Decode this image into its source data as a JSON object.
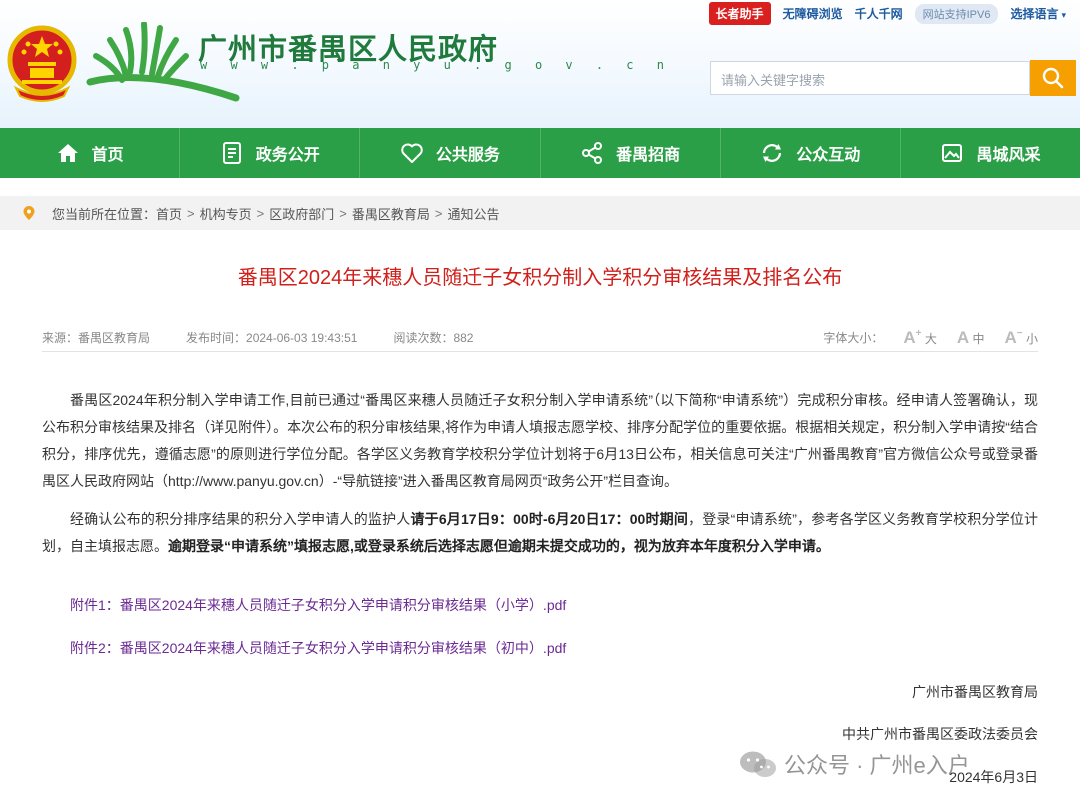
{
  "site": {
    "title": "广州市番禺区人民政府",
    "url": "w w w . p a n y u . g o v . c n"
  },
  "topbar": {
    "elder": "长者助手",
    "accessible": "无障碍浏览",
    "thousand": "千人千网",
    "ipv6": "网站支持IPV6",
    "lang": "选择语言"
  },
  "search": {
    "placeholder": "请输入关键字搜索"
  },
  "nav": [
    {
      "label": "首页",
      "icon": "home-icon"
    },
    {
      "label": "政务公开",
      "icon": "document-icon"
    },
    {
      "label": "公共服务",
      "icon": "heart-icon"
    },
    {
      "label": "番禺招商",
      "icon": "share-icon"
    },
    {
      "label": "公众互动",
      "icon": "refresh-icon"
    },
    {
      "label": "禺城风采",
      "icon": "image-icon"
    }
  ],
  "breadcrumb": {
    "prefix": "您当前所在位置：",
    "items": [
      "首页",
      "机构专页",
      "区政府部门",
      "番禺区教育局",
      "通知公告"
    ]
  },
  "article": {
    "title": "番禺区2024年来穗人员随迁子女积分制入学积分审核结果及排名公布",
    "source": "来源：番禺区教育局",
    "published": "发布时间：2024-06-03 19:43:51",
    "reads": "阅读次数：882",
    "font_size_label": "字体大小：",
    "font_big": "大",
    "font_mid": "中",
    "font_small": "小",
    "para1": "番禺区2024年积分制入学申请工作,目前已通过“番禺区来穗人员随迁子女积分制入学申请系统”（以下简称“申请系统”）完成积分审核。经申请人签署确认，现公布积分审核结果及排名（详见附件）。本次公布的积分审核结果,将作为申请人填报志愿学校、排序分配学位的重要依据。根据相关规定，积分制入学申请按“结合积分，排序优先，遵循志愿”的原则进行学位分配。各学区义务教育学校积分学位计划将于6月13日公布，相关信息可关注“广州番禺教育”官方微信公众号或登录番禺区人民政府网站（http://www.panyu.gov.cn）-“导航链接”进入番禺区教育局网页“政务公开”栏目查询。",
    "para2_a": "经确认公布的积分排序结果的积分入学申请人的监护人",
    "para2_b": "请于6月17日9：00时-6月20日17：00时期间",
    "para2_c": "，登录“申请系统”，参考各学区义务教育学校积分学位计划，自主填报志愿。",
    "para2_d": "逾期登录“申请系统”填报志愿,或登录系统后选择志愿但逾期未提交成功的，视为放弃本年度积分入学申请。",
    "attachment1": "附件1：番禺区2024年来穗人员随迁子女积分入学申请积分审核结果（小学）.pdf",
    "attachment2": "附件2：番禺区2024年来穗人员随迁子女积分入学申请积分审核结果（初中）.pdf",
    "signer1": "广州市番禺区教育局",
    "signer2": "中共广州市番禺区委政法委员会",
    "date": "2024年6月3日"
  },
  "watermark": "公众号 · 广州e入户",
  "colors": {
    "nav_green": "#2a9f47",
    "title_red": "#d0201b",
    "search_orange": "#f5a000",
    "attachment_purple": "#6b2b93"
  }
}
